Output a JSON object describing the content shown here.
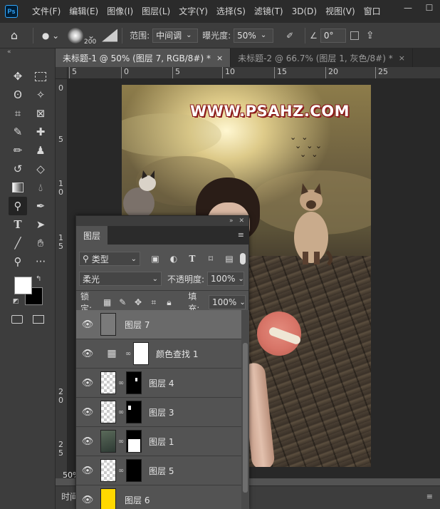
{
  "app": {
    "logo": "Ps",
    "menu": [
      "文件(F)",
      "编辑(E)",
      "图像(I)",
      "图层(L)",
      "文字(Y)",
      "选择(S)",
      "滤镜(T)",
      "3D(D)",
      "视图(V)",
      "窗口"
    ],
    "window_controls": [
      "—",
      "☐"
    ]
  },
  "options": {
    "brush_size": "200",
    "range_label": "范围:",
    "range_value": "中间调",
    "exposure_label": "曝光度:",
    "exposure_value": "50%",
    "angle_value": "0°"
  },
  "toolbar": {
    "collapse": "«"
  },
  "colors": {
    "foreground": "#ffffff",
    "background": "#000000"
  },
  "tabs": [
    {
      "label": "未标题-1 @ 50% (图层 7, RGB/8#) *",
      "close": "×"
    },
    {
      "label": "未标题-2 @ 66.7% (图层 1, 灰色/8#) *",
      "close": "×"
    }
  ],
  "rulers": {
    "h": [
      "5",
      "0",
      "5",
      "10",
      "15",
      "20",
      "25"
    ],
    "v": [
      "0",
      "5",
      "1",
      "0",
      "1",
      "5",
      "2",
      "0",
      "2",
      "5"
    ]
  },
  "canvas": {
    "watermark": "WWW.PSAHZ.COM",
    "zoom": "50%"
  },
  "status": {
    "timeline": "时间",
    "menu": "≡"
  },
  "layers_panel": {
    "title": "图层",
    "filter_kind": "类型",
    "blend_mode": "柔光",
    "opacity_label": "不透明度:",
    "opacity_value": "100%",
    "lock_label": "锁定:",
    "fill_label": "填充:",
    "fill_value": "100%",
    "layers": [
      {
        "name": "图层 7",
        "selected": true
      },
      {
        "name": "颜色查找 1",
        "selected": false
      },
      {
        "name": "图层 4",
        "selected": false
      },
      {
        "name": "图层 3",
        "selected": false
      },
      {
        "name": "图层 1",
        "selected": false
      },
      {
        "name": "图层 5",
        "selected": false
      },
      {
        "name": "图层 6",
        "selected": false
      }
    ]
  }
}
